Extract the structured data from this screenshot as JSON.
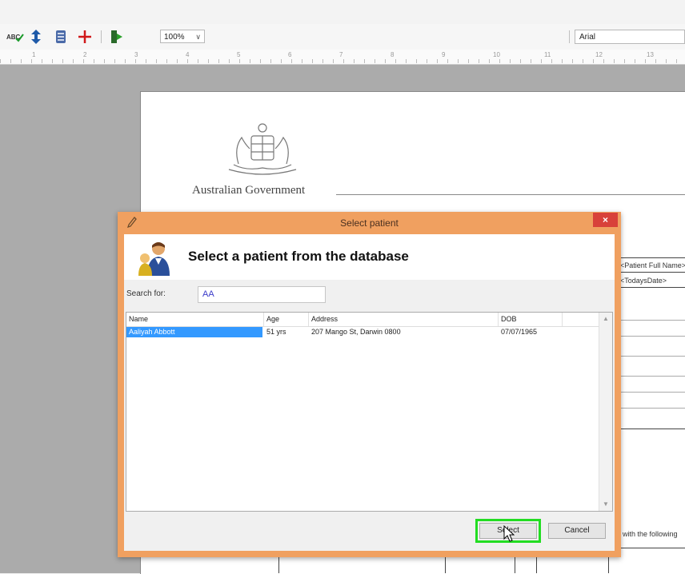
{
  "toolbar": {
    "zoom_value": "100%",
    "font_value": "Arial"
  },
  "ruler": {
    "labels": [
      "1",
      "2",
      "3",
      "4",
      "5",
      "6",
      "7",
      "8",
      "9",
      "10",
      "11",
      "12",
      "13"
    ]
  },
  "document": {
    "government_text": "Australian Government",
    "field_1": "<Patient Full Name>",
    "field_2": "<TodaysDate>",
    "footer_text": "with the following"
  },
  "dialog": {
    "title": "Select patient",
    "close_label": "×",
    "header_title": "Select a patient from the database",
    "search_label": "Search for:",
    "search_value": "AA",
    "columns": [
      "Name",
      "Age",
      "Address",
      "DOB"
    ],
    "rows": [
      {
        "name": "Aaliyah Abbott",
        "age": "51 yrs",
        "address": "207 Mango St, Darwin 0800",
        "dob": "07/07/1965",
        "selected": true
      }
    ],
    "select_label": "Select",
    "cancel_label": "Cancel"
  },
  "colors": {
    "dialog_border": "#f0a060",
    "selection": "#3399ff",
    "highlight": "#22dd22",
    "close_button": "#d8413a"
  }
}
